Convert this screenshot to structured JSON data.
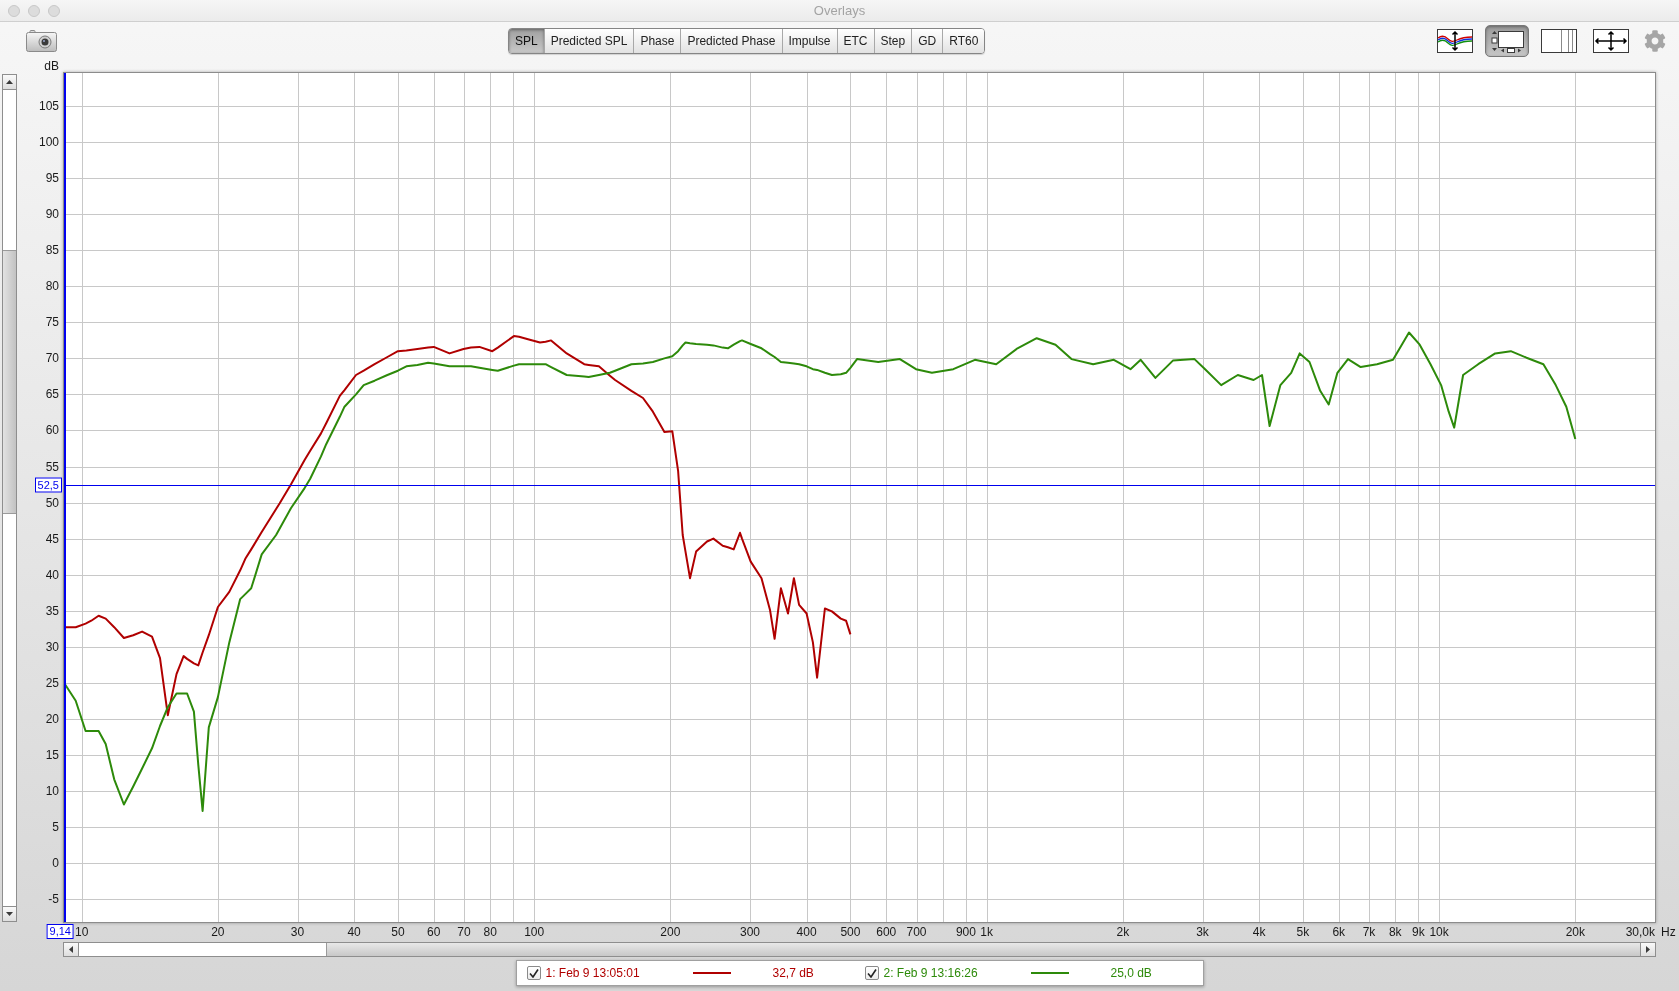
{
  "window": {
    "title": "Overlays"
  },
  "tabs": [
    {
      "label": "SPL",
      "selected": true
    },
    {
      "label": "Predicted SPL",
      "selected": false
    },
    {
      "label": "Phase",
      "selected": false
    },
    {
      "label": "Predicted Phase",
      "selected": false
    },
    {
      "label": "Impulse",
      "selected": false
    },
    {
      "label": "ETC",
      "selected": false
    },
    {
      "label": "Step",
      "selected": false
    },
    {
      "label": "GD",
      "selected": false
    },
    {
      "label": "RT60",
      "selected": false
    }
  ],
  "graph_tools": [
    {
      "kind": "limits",
      "selected": false
    },
    {
      "kind": "controls",
      "selected": true
    },
    {
      "kind": "grid",
      "selected": false
    },
    {
      "kind": "pan",
      "selected": false
    }
  ],
  "plot": {
    "chart_data": {
      "type": "line",
      "xlabel": "Hz",
      "ylabel": "dB",
      "grid": true,
      "log": "x",
      "xlim": [
        9.14,
        30000
      ],
      "ylim": [
        -8.2,
        109.6
      ],
      "xticks": [
        10,
        20,
        30,
        40,
        50,
        60,
        70,
        80,
        100,
        200,
        300,
        400,
        500,
        600,
        700,
        900,
        {
          "value": 1000,
          "label": "1k"
        },
        {
          "value": 2000,
          "label": "2k"
        },
        {
          "value": 3000,
          "label": "3k"
        },
        {
          "value": 4000,
          "label": "4k"
        },
        {
          "value": 5000,
          "label": "5k"
        },
        {
          "value": 6000,
          "label": "6k"
        },
        {
          "value": 7000,
          "label": "7k"
        },
        {
          "value": 8000,
          "label": "8k"
        },
        {
          "value": 9000,
          "label": "9k"
        },
        {
          "value": 10000,
          "label": "10k"
        },
        {
          "value": 20000,
          "label": "20k"
        },
        {
          "value": 30000,
          "label": "30,0k"
        }
      ],
      "yticks": [
        -5,
        0,
        5,
        10,
        15,
        20,
        25,
        30,
        35,
        40,
        45,
        50,
        55,
        60,
        65,
        70,
        75,
        80,
        85,
        90,
        95,
        100,
        105
      ],
      "x": [
        9.14,
        9.7,
        10.2,
        10.5,
        10.9,
        11.3,
        11.8,
        12.4,
        13.0,
        13.6,
        14.3,
        14.9,
        15.5,
        16.2,
        16.8,
        17.1,
        17.7,
        18.1,
        18.5,
        19.1,
        20.0,
        21.2,
        22.4,
        23.0,
        23.7,
        25.0,
        26.9,
        27.4,
        29.0,
        31.1,
        32.0,
        33.8,
        34.7,
        37.2,
        38.1,
        40.4,
        42.0,
        44.4,
        47.4,
        50.0,
        52.2,
        55.2,
        58.3,
        60.0,
        65.0,
        69.8,
        72.5,
        75.7,
        80.8,
        83.1,
        90.2,
        92.6,
        97.8,
        103,
        106,
        109,
        118,
        129,
        132,
        139,
        147,
        151,
        164,
        174,
        183,
        194,
        202,
        208,
        213,
        216,
        221,
        228,
        241,
        249,
        261,
        268,
        276,
        285,
        288,
        301,
        318,
        332,
        340,
        351,
        364,
        375,
        385,
        400,
        413,
        422,
        439,
        455,
        476,
        489,
        500,
        517,
        576,
        643,
        698,
        757,
        844,
        942,
        1050,
        1170,
        1290,
        1420,
        1540,
        1720,
        1910,
        2080,
        2190,
        2360,
        2580,
        2880,
        3040,
        3300,
        3590,
        3890,
        4060,
        4220,
        4460,
        4710,
        4920,
        5170,
        5460,
        5700,
        5960,
        6290,
        6710,
        7290,
        7910,
        8580,
        9060,
        9570,
        10100,
        10500,
        10800,
        11300,
        12200,
        13300,
        14400,
        15600,
        17000,
        18100,
        19100,
        20000
      ],
      "series": [
        {
          "name": "1: Feb 9 13:05:01",
          "color": "#b00000",
          "values": [
            32.7,
            32.7,
            33.2,
            33.6,
            34.3,
            33.9,
            32.7,
            31.2,
            31.6,
            32.1,
            31.4,
            28.4,
            20.5,
            26.2,
            28.7,
            28.3,
            27.7,
            27.4,
            29.2,
            31.6,
            35.5,
            37.6,
            40.6,
            42.2,
            43.5,
            45.9,
            49.1,
            49.9,
            52.5,
            55.9,
            57.2,
            59.6,
            61.0,
            64.8,
            65.6,
            67.7,
            68.3,
            69.2,
            70.2,
            71.0,
            71.1,
            71.3,
            71.5,
            71.6,
            70.7,
            71.3,
            71.5,
            71.6,
            71.0,
            71.5,
            73.1,
            73.0,
            72.6,
            72.2,
            72.3,
            72.5,
            70.7,
            69.2,
            69.1,
            68.9,
            67.6,
            67.0,
            65.5,
            64.5,
            62.6,
            59.8,
            59.9,
            54.4,
            45.5,
            43.2,
            39.5,
            43.2,
            44.6,
            45.0,
            44.0,
            43.8,
            43.5,
            45.8,
            45.0,
            41.8,
            39.5,
            35.1,
            31.1,
            38.1,
            34.6,
            39.5,
            35.8,
            34.6,
            30.6,
            25.7,
            35.3,
            34.9,
            33.9,
            33.6,
            31.7,
            null,
            null,
            null,
            null,
            null,
            null,
            null,
            null,
            null,
            null,
            null,
            null,
            null,
            null,
            null,
            null,
            null,
            null,
            null,
            null,
            null,
            null,
            null,
            null,
            null,
            null,
            null,
            null,
            null,
            null,
            null,
            null,
            null,
            null,
            null,
            null,
            null,
            null,
            null,
            null,
            null,
            null,
            null,
            null,
            null,
            null,
            null,
            null,
            null,
            null,
            null
          ]
        },
        {
          "name": "2: Feb 9 13:16:26",
          "color": "#2d8a0a",
          "values": [
            25.0,
            22.5,
            18.3,
            18.3,
            18.3,
            16.5,
            11.6,
            8.1,
            10.6,
            13.1,
            15.9,
            19.0,
            21.6,
            23.5,
            23.5,
            23.5,
            21.0,
            13.6,
            7.2,
            18.8,
            23.0,
            30.6,
            36.6,
            37.3,
            38.1,
            42.8,
            45.5,
            46.4,
            49.2,
            52.0,
            53.3,
            56.4,
            58.1,
            61.9,
            63.3,
            65.0,
            66.3,
            66.9,
            67.7,
            68.3,
            68.9,
            69.1,
            69.4,
            69.3,
            68.9,
            68.9,
            68.9,
            68.7,
            68.4,
            68.3,
            69.0,
            69.2,
            69.2,
            69.2,
            69.2,
            68.8,
            67.7,
            67.5,
            67.4,
            67.7,
            68.0,
            68.3,
            69.2,
            69.3,
            69.5,
            70.0,
            70.3,
            71.0,
            71.8,
            72.2,
            72.1,
            72.0,
            71.9,
            71.8,
            71.5,
            71.4,
            71.9,
            72.4,
            72.5,
            72.0,
            71.4,
            70.6,
            70.2,
            69.5,
            69.4,
            69.3,
            69.2,
            68.9,
            68.5,
            68.4,
            68.0,
            67.7,
            67.8,
            68.0,
            68.7,
            69.9,
            69.5,
            69.9,
            68.5,
            68.0,
            68.5,
            69.8,
            69.2,
            71.4,
            72.8,
            71.9,
            69.9,
            69.2,
            69.8,
            68.5,
            69.8,
            67.3,
            69.7,
            69.9,
            68.5,
            66.3,
            67.7,
            67.0,
            67.7,
            60.6,
            66.3,
            68.0,
            70.7,
            69.5,
            65.5,
            63.6,
            68.0,
            69.9,
            68.8,
            69.2,
            69.8,
            73.6,
            71.9,
            69.2,
            66.3,
            62.6,
            60.4,
            67.7,
            69.2,
            70.7,
            71.0,
            70.1,
            69.2,
            66.3,
            63.3,
            58.8
          ]
        }
      ],
      "ref_lines": [
        {
          "axis": "x",
          "value": 9.14,
          "label": "9,14"
        },
        {
          "axis": "y",
          "value": 52.5,
          "label": "52,5"
        }
      ]
    }
  },
  "legend": [
    {
      "checked": true,
      "reading": "32,7 dB"
    },
    {
      "checked": true,
      "reading": "25,0 dB"
    }
  ]
}
